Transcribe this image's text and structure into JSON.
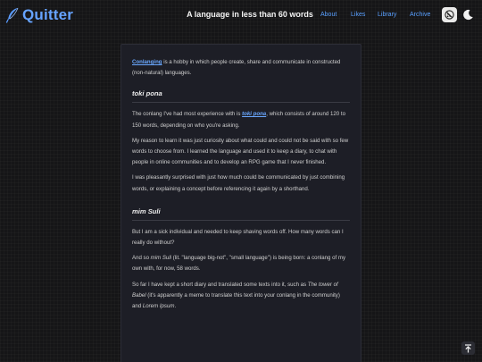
{
  "header": {
    "brand": "Quitter",
    "title": "A language in less than 60 words",
    "nav": [
      "About",
      "Likes",
      "Library",
      "Archive"
    ],
    "icons": {
      "brand": "quill-icon",
      "rss": "rss-crossed-icon",
      "theme": "moon-icon",
      "scroll": "scroll-to-top-icon"
    }
  },
  "colors": {
    "accent": "#66a3ff",
    "background": "#151517",
    "card": "#1d1e26"
  },
  "article": {
    "intro": {
      "link": "Conlanging",
      "text1": " is a hobby in which people create, share and communicate in constructed (non-natural) languages."
    },
    "section1": {
      "heading": "toki pona",
      "p1_a": "The conlang I've had most experience with is ",
      "p1_link": "toki pona",
      "p1_b": ", which consists of around 120 to 150 words, depending on who you're asking.",
      "p2": "My reason to learn it was just curiosity about what could and could not be said with so few words to choose from. I learned the language and used it to keep a diary, to chat with people in online communities and to develop an RPG game that I never finished.",
      "p3": "I was pleasantly surprised with just how much could be communicated by just combining words, or explaining a concept before referencing it again by a shorthand."
    },
    "section2": {
      "heading": "mim Suli",
      "p1": "But I am a sick individual and needed to keep shaving words off. How many words can I really do without?",
      "p2_a": "And so ",
      "p2_em": "mim Suli",
      "p2_b": " (lit. \"language big-not\", \"small language\") is being born: a conlang of my own with, for now, 58 words.",
      "p3_a": "So far I have kept a short diary and translated some texts into it, such as ",
      "p3_em1": "The tower of Babel",
      "p3_b": " (it's apparently a meme to translate this text into your conlang in the community) and ",
      "p3_em2": "Lorem Ipsum",
      "p3_c": "."
    }
  }
}
